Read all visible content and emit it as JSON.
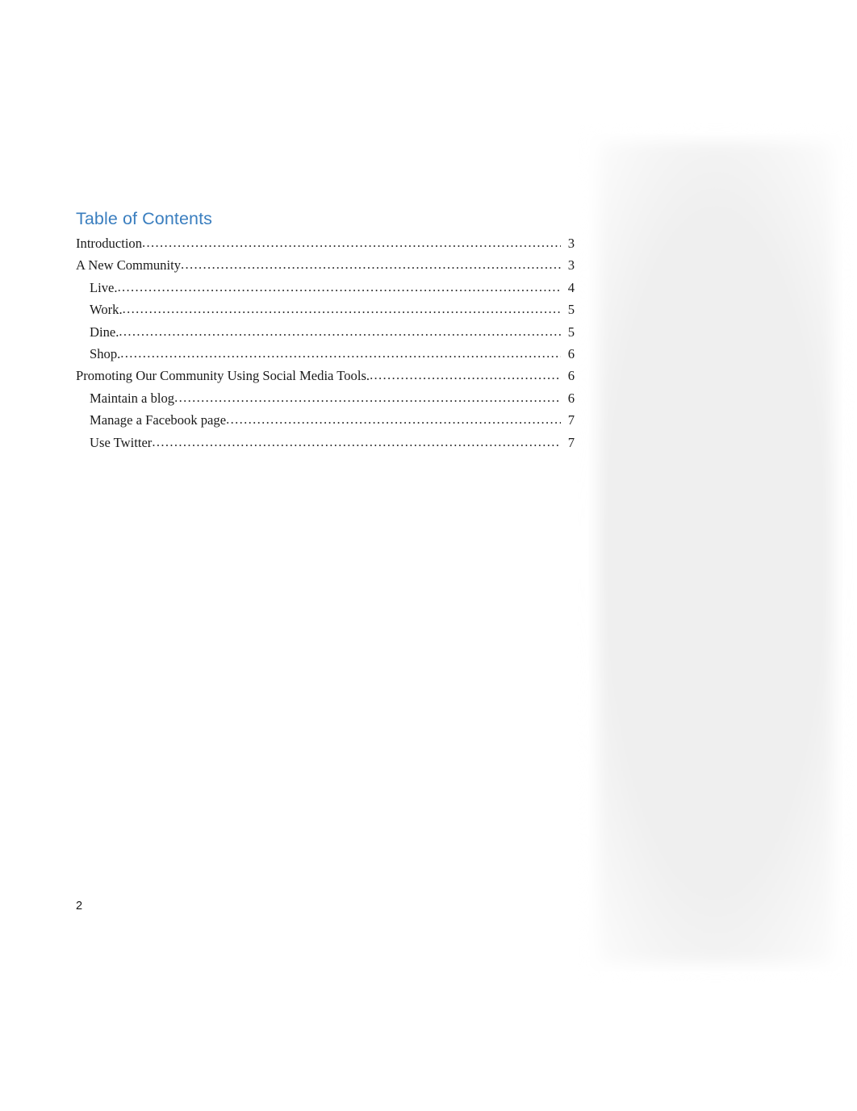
{
  "document": {
    "heading": "Table of Contents",
    "heading_color": "#3a7ebf",
    "page_number": "2"
  },
  "toc": {
    "entries": [
      {
        "label": "Introduction",
        "page": "3",
        "level": 1
      },
      {
        "label": "A New Community",
        "page": "3",
        "level": 1
      },
      {
        "label": "Live.",
        "page": "4",
        "level": 2
      },
      {
        "label": "Work. ",
        "page": "5",
        "level": 2
      },
      {
        "label": "Dine.",
        "page": "5",
        "level": 2
      },
      {
        "label": "Shop. ",
        "page": "6",
        "level": 2
      },
      {
        "label": "Promoting Our Community Using Social Media Tools. ",
        "page": "6",
        "level": 1
      },
      {
        "label": "Maintain a blog ",
        "page": "6",
        "level": 2
      },
      {
        "label": "Manage a Facebook page",
        "page": "7",
        "level": 2
      },
      {
        "label": "Use Twitter",
        "page": "7",
        "level": 2
      }
    ]
  },
  "decoration": {
    "panel_color": "#efefef"
  }
}
